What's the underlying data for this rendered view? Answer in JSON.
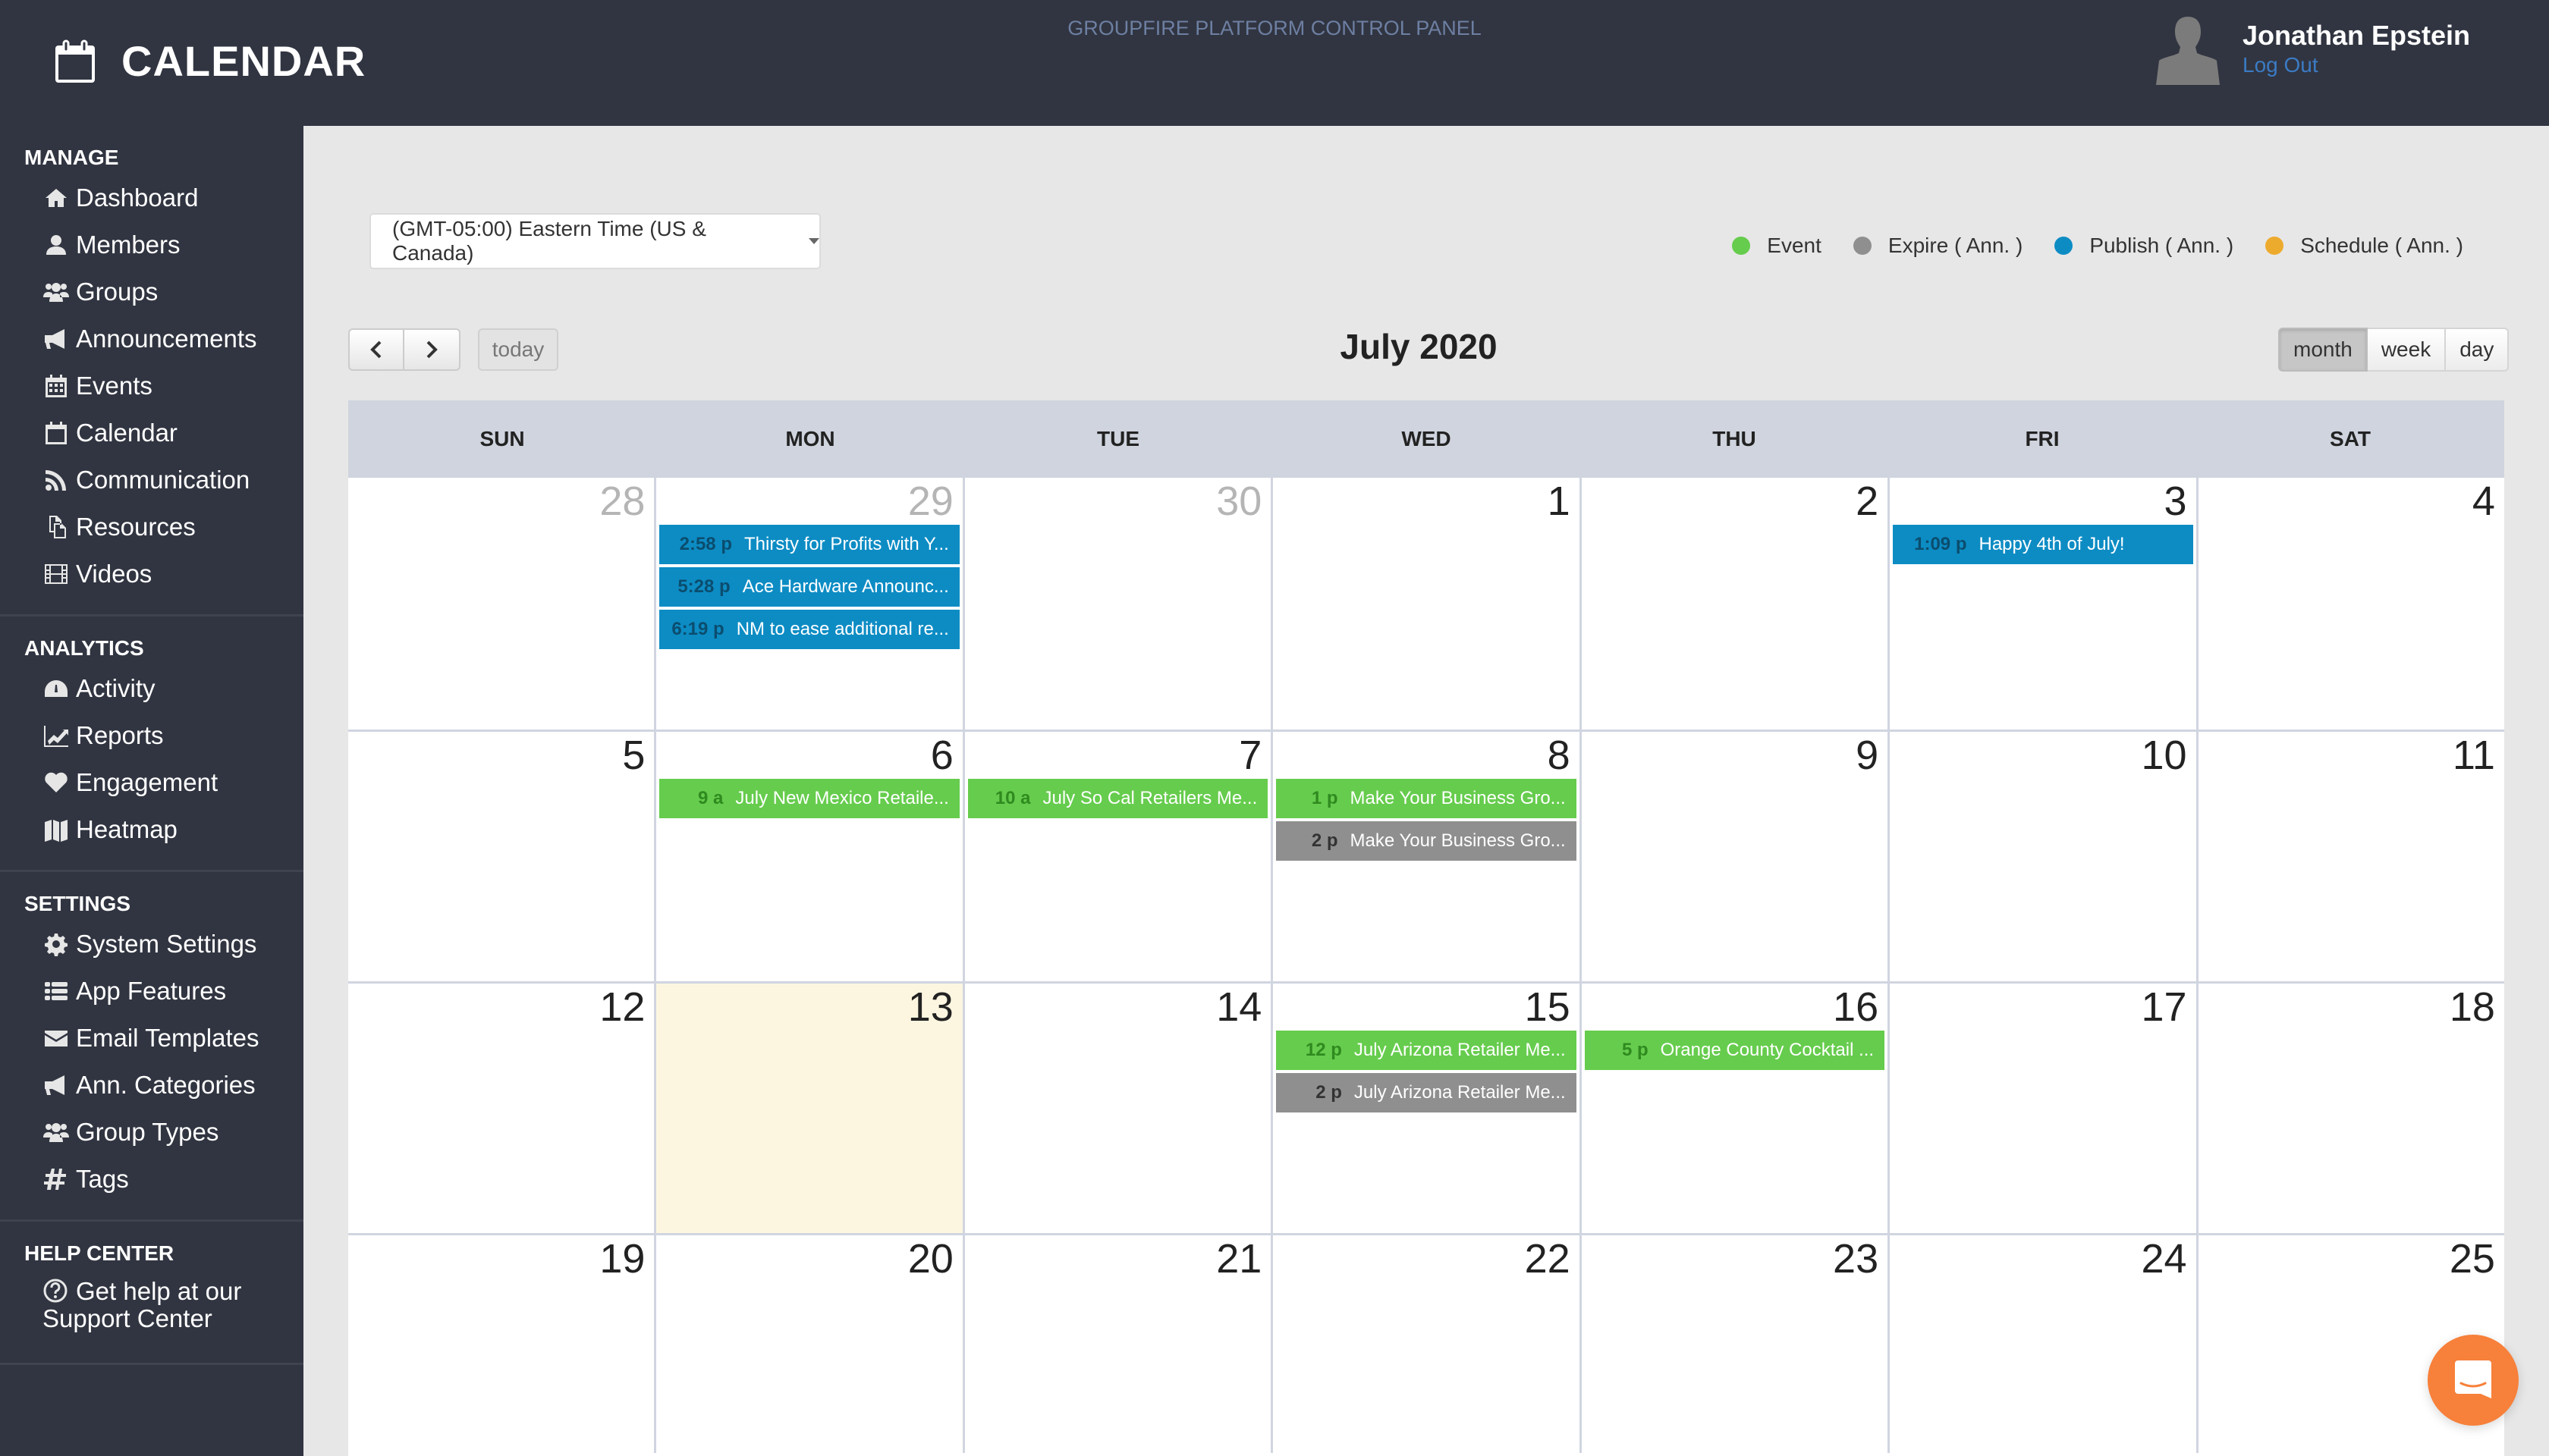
{
  "header": {
    "app_title": "CALENDAR",
    "platform_label": "GROUPFIRE PLATFORM CONTROL PANEL",
    "user_name": "Jonathan Epstein",
    "logout_label": "Log Out"
  },
  "sidebar": {
    "sections": [
      {
        "title": "MANAGE",
        "items": [
          {
            "label": "Dashboard",
            "icon": "home-icon"
          },
          {
            "label": "Members",
            "icon": "user-icon"
          },
          {
            "label": "Groups",
            "icon": "users-icon"
          },
          {
            "label": "Announcements",
            "icon": "bullhorn-icon"
          },
          {
            "label": "Events",
            "icon": "calendar-grid-icon"
          },
          {
            "label": "Calendar",
            "icon": "calendar-icon"
          },
          {
            "label": "Communication",
            "icon": "rss-icon"
          },
          {
            "label": "Resources",
            "icon": "files-icon"
          },
          {
            "label": "Videos",
            "icon": "film-icon"
          }
        ]
      },
      {
        "title": "ANALYTICS",
        "items": [
          {
            "label": "Activity",
            "icon": "dashboard-gauge-icon"
          },
          {
            "label": "Reports",
            "icon": "line-chart-icon"
          },
          {
            "label": "Engagement",
            "icon": "heart-icon"
          },
          {
            "label": "Heatmap",
            "icon": "map-icon"
          }
        ]
      },
      {
        "title": "SETTINGS",
        "items": [
          {
            "label": "System Settings",
            "icon": "gear-icon"
          },
          {
            "label": "App Features",
            "icon": "list-icon"
          },
          {
            "label": "Email Templates",
            "icon": "envelope-icon"
          },
          {
            "label": "Ann. Categories",
            "icon": "bullhorn-icon"
          },
          {
            "label": "Group Types",
            "icon": "users-icon"
          },
          {
            "label": "Tags",
            "icon": "hashtag-icon"
          }
        ]
      },
      {
        "title": "HELP CENTER",
        "items": [
          {
            "label": "Get help at our Support Center",
            "icon": "question-circle-icon"
          }
        ]
      }
    ]
  },
  "toolbar": {
    "timezone": "(GMT-05:00) Eastern Time (US & Canada)",
    "today_label": "today",
    "month_title": "July 2020",
    "views": [
      "month",
      "week",
      "day"
    ],
    "active_view": "month"
  },
  "legend": [
    {
      "label": "Event",
      "color": "#66cc4d"
    },
    {
      "label": "Expire ( Ann. )",
      "color": "#8f8f8f"
    },
    {
      "label": "Publish ( Ann. )",
      "color": "#0d8cc4"
    },
    {
      "label": "Schedule ( Ann. )",
      "color": "#edab2d"
    }
  ],
  "calendar": {
    "weekdays": [
      "SUN",
      "MON",
      "TUE",
      "WED",
      "THU",
      "FRI",
      "SAT"
    ],
    "today": 13,
    "weeks": [
      [
        {
          "day": "28",
          "other": true,
          "events": []
        },
        {
          "day": "29",
          "other": true,
          "events": [
            {
              "time": "2:58 p",
              "title": "Thirsty for Profits with Y...",
              "type": "publish"
            },
            {
              "time": "5:28 p",
              "title": "Ace Hardware Announc...",
              "type": "publish"
            },
            {
              "time": "6:19 p",
              "title": "NM to ease additional re...",
              "type": "publish"
            }
          ]
        },
        {
          "day": "30",
          "other": true,
          "events": []
        },
        {
          "day": "1",
          "events": []
        },
        {
          "day": "2",
          "events": []
        },
        {
          "day": "3",
          "events": [
            {
              "time": "1:09 p",
              "title": "Happy 4th of July!",
              "type": "publish"
            }
          ]
        },
        {
          "day": "4",
          "events": []
        }
      ],
      [
        {
          "day": "5",
          "events": []
        },
        {
          "day": "6",
          "events": [
            {
              "time": "9 a",
              "title": "July New Mexico Retaile...",
              "type": "event"
            }
          ]
        },
        {
          "day": "7",
          "events": [
            {
              "time": "10 a",
              "title": "July So Cal Retailers Me...",
              "type": "event"
            }
          ]
        },
        {
          "day": "8",
          "events": [
            {
              "time": "1 p",
              "title": "Make Your Business Gro...",
              "type": "event"
            },
            {
              "time": "2 p",
              "title": "Make Your Business Gro...",
              "type": "expire"
            }
          ]
        },
        {
          "day": "9",
          "events": []
        },
        {
          "day": "10",
          "events": []
        },
        {
          "day": "11",
          "events": []
        }
      ],
      [
        {
          "day": "12",
          "events": []
        },
        {
          "day": "13",
          "events": []
        },
        {
          "day": "14",
          "events": []
        },
        {
          "day": "15",
          "events": [
            {
              "time": "12 p",
              "title": "July Arizona Retailer Me...",
              "type": "event"
            },
            {
              "time": "2 p",
              "title": "July Arizona Retailer Me...",
              "type": "expire"
            }
          ]
        },
        {
          "day": "16",
          "events": [
            {
              "time": "5 p",
              "title": "Orange County Cocktail ...",
              "type": "event"
            }
          ]
        },
        {
          "day": "17",
          "events": []
        },
        {
          "day": "18",
          "events": []
        }
      ],
      [
        {
          "day": "19",
          "events": []
        },
        {
          "day": "20",
          "events": []
        },
        {
          "day": "21",
          "events": []
        },
        {
          "day": "22",
          "events": []
        },
        {
          "day": "23",
          "events": []
        },
        {
          "day": "24",
          "events": []
        },
        {
          "day": "25",
          "events": []
        }
      ]
    ],
    "event_colors": {
      "event": {
        "bg": "#66cc4d",
        "time": "#2f8a1f"
      },
      "expire": {
        "bg": "#8f8f8f",
        "time": "#333333"
      },
      "publish": {
        "bg": "#0d8cc4",
        "time": "#0b4d6e"
      },
      "schedule": {
        "bg": "#edab2d",
        "time": "#7a5410"
      }
    }
  },
  "chat_widget": {
    "icon": "chat-icon",
    "color": "#f7803a"
  }
}
